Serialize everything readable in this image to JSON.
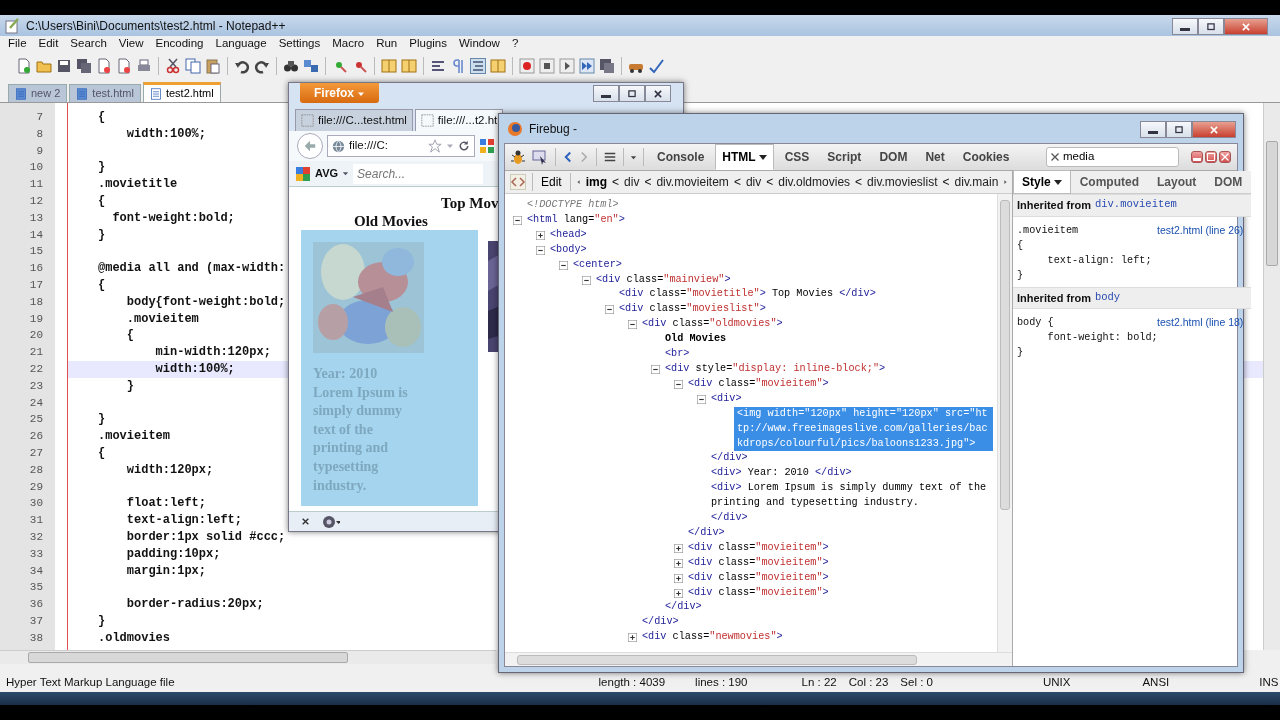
{
  "notepad": {
    "title": "C:\\Users\\Bini\\Documents\\test2.html - Notepad++",
    "menu": [
      "File",
      "Edit",
      "Search",
      "View",
      "Encoding",
      "Language",
      "Settings",
      "Macro",
      "Run",
      "Plugins",
      "Window",
      "?"
    ],
    "tabs": [
      {
        "label": "new 2",
        "selected": false
      },
      {
        "label": "test.html",
        "selected": false
      },
      {
        "label": "test2.html",
        "selected": true
      }
    ],
    "lines": [
      {
        "number": "7",
        "text": "{",
        "current": false
      },
      {
        "number": "8",
        "text": "    width:100%;",
        "current": false
      },
      {
        "number": "9",
        "current": false
      },
      {
        "number": "10",
        "text": "}",
        "current": false
      },
      {
        "number": "11",
        "text": ".movietitle",
        "current": false
      },
      {
        "number": "12",
        "text": "{",
        "current": false
      },
      {
        "number": "13",
        "text": "  font-weight:bold;",
        "current": false
      },
      {
        "number": "14",
        "text": "}",
        "current": false
      },
      {
        "number": "15",
        "current": false
      },
      {
        "number": "16",
        "text": "@media all and (max-width:",
        "current": false
      },
      {
        "number": "17",
        "text": "{",
        "current": false
      },
      {
        "number": "18",
        "text": "    body{font-weight:bold;",
        "current": false
      },
      {
        "number": "19",
        "text": "    .movieitem",
        "current": false
      },
      {
        "number": "20",
        "text": "    {",
        "current": false
      },
      {
        "number": "21",
        "text": "        min-width:120px;",
        "current": false
      },
      {
        "number": "22",
        "text": "        width:100%;",
        "current": true
      },
      {
        "number": "23",
        "text": "    }",
        "current": false
      },
      {
        "number": "24",
        "current": false
      },
      {
        "number": "25",
        "text": "}",
        "current": false
      },
      {
        "number": "26",
        "text": ".movieitem",
        "current": false
      },
      {
        "number": "27",
        "text": "{",
        "current": false
      },
      {
        "number": "28",
        "text": "    width:120px;",
        "current": false
      },
      {
        "number": "29",
        "current": false
      },
      {
        "number": "30",
        "text": "    float:left;",
        "current": false
      },
      {
        "number": "31",
        "text": "    text-align:left;",
        "current": false
      },
      {
        "number": "32",
        "text": "    border:1px solid #ccc;",
        "current": false
      },
      {
        "number": "33",
        "text": "    padding:10px;",
        "current": false
      },
      {
        "number": "34",
        "text": "    margin:1px;",
        "current": false
      },
      {
        "number": "35",
        "current": false
      },
      {
        "number": "36",
        "text": "    border-radius:20px;",
        "current": false
      },
      {
        "number": "37",
        "text": "}",
        "current": false
      },
      {
        "number": "38",
        "text": ".oldmovies",
        "current": false
      }
    ],
    "status_bar": {
      "file_type": "Hyper Text Markup Language file",
      "length": "length : 4039",
      "lines": "lines : 190",
      "line": "Ln : 22",
      "column": "Col : 23",
      "selection": "Sel : 0",
      "eol": "UNIX",
      "encoding": "ANSI",
      "mode": "INS"
    }
  },
  "firefox": {
    "menu_button": "Firefox",
    "tabs": [
      {
        "label": "file:///C...test.html",
        "selected": false
      },
      {
        "label": "file:///...t2.ht",
        "selected": true
      }
    ],
    "address": "file:///C:",
    "toolbar_brand": "AVG",
    "search": {
      "placeholder": "Search..."
    },
    "page": {
      "title": "Top Mov",
      "section": "Old Movies",
      "movie": {
        "year": "Year: 2010",
        "description": "Lorem Ipsum is simply dummy text of the printing and typesetting industry."
      }
    }
  },
  "firebug": {
    "title": "Firebug -",
    "panels": [
      {
        "label": "Console",
        "selected": false
      },
      {
        "label": "HTML",
        "selected": true,
        "menu": true
      },
      {
        "label": "CSS",
        "selected": false
      },
      {
        "label": "Script",
        "selected": false
      },
      {
        "label": "DOM",
        "selected": false
      },
      {
        "label": "Net",
        "selected": false
      },
      {
        "label": "Cookies",
        "selected": false
      }
    ],
    "search": {
      "value": "media"
    },
    "edit_button": "Edit",
    "breadcrumb": [
      {
        "label": "img",
        "selected": true,
        "separator": "<"
      },
      {
        "label": "div",
        "selected": false,
        "separator": "<"
      },
      {
        "label": "div.movieitem",
        "selected": false,
        "separator": "<"
      },
      {
        "label": "div",
        "selected": false,
        "separator": "<"
      },
      {
        "label": "div.oldmovies",
        "selected": false,
        "separator": "<"
      },
      {
        "label": "div.movieslist",
        "selected": false,
        "separator": "<"
      },
      {
        "label": "div.main",
        "selected": false
      }
    ],
    "side_tabs": [
      {
        "label": "Style",
        "selected": true,
        "menu": true
      },
      {
        "label": "Computed",
        "selected": false
      },
      {
        "label": "Layout",
        "selected": false
      },
      {
        "label": "DOM",
        "selected": false
      }
    ],
    "tree": [
      {
        "kind": "doctype",
        "text": "<!DOCTYPE html>",
        "selected": false
      },
      {
        "kind": "element",
        "text": "<html lang=\"en\">",
        "expanded": true,
        "selected": false,
        "children": [
          {
            "kind": "element",
            "text": "<head>",
            "expanded": false,
            "selected": false
          },
          {
            "kind": "element",
            "text": "<body>",
            "expanded": true,
            "selected": false,
            "children": [
              {
                "kind": "element",
                "text": "<center>",
                "expanded": true,
                "selected": false,
                "children": [
                  {
                    "kind": "element",
                    "text": "<div class=\"mainview\">",
                    "expanded": true,
                    "selected": false,
                    "children": [
                      {
                        "kind": "element",
                        "text": "<div class=\"movietitle\"> Top Movies </div>",
                        "selected": false
                      },
                      {
                        "kind": "element",
                        "text": "<div class=\"movieslist\">",
                        "expanded": true,
                        "selected": false,
                        "children": [
                          {
                            "kind": "element",
                            "text": "<div class=\"oldmovies\">",
                            "expanded": true,
                            "selected": false,
                            "close": "</div>",
                            "children": [
                              {
                                "kind": "text",
                                "text": "Old Movies",
                                "selected": false
                              },
                              {
                                "kind": "element",
                                "text": "<br>",
                                "selected": false
                              },
                              {
                                "kind": "element",
                                "text": "<div style=\"display: inline-block;\">",
                                "expanded": true,
                                "selected": false,
                                "close": "</div>",
                                "children": [
                                  {
                                    "kind": "element",
                                    "text": "<div class=\"movieitem\">",
                                    "expanded": true,
                                    "selected": false,
                                    "close": "</div>",
                                    "children": [
                                      {
                                        "kind": "element",
                                        "text": "<div>",
                                        "expanded": true,
                                        "selected": false,
                                        "close": "</div>",
                                        "children": [
                                          {
                                            "kind": "element",
                                            "text": "<img width=\"120px\" height=\"120px\" src=\"http://www.freeimageslive.com/galleries/backdrops/colourful/pics/baloons1233.jpg\">",
                                            "selected": true
                                          }
                                        ]
                                      },
                                      {
                                        "kind": "element",
                                        "text": "<div> Year: 2010 </div>",
                                        "selected": false
                                      },
                                      {
                                        "kind": "element",
                                        "text": "<div> Lorem Ipsum is simply dummy text of the printing and typesetting industry.",
                                        "close": "</div>",
                                        "selected": false
                                      }
                                    ]
                                  },
                                  {
                                    "kind": "element",
                                    "text": "<div class=\"movieitem\">",
                                    "expanded": false,
                                    "selected": false
                                  },
                                  {
                                    "kind": "element",
                                    "text": "<div class=\"movieitem\">",
                                    "expanded": false,
                                    "selected": false
                                  },
                                  {
                                    "kind": "element",
                                    "text": "<div class=\"movieitem\">",
                                    "expanded": false,
                                    "selected": false
                                  },
                                  {
                                    "kind": "element",
                                    "text": "<div class=\"movieitem\">",
                                    "expanded": false,
                                    "selected": false
                                  }
                                ]
                              }
                            ]
                          },
                          {
                            "kind": "element",
                            "text": "<div class=\"newmovies\">",
                            "expanded": false,
                            "selected": false
                          }
                        ]
                      }
                    ]
                  }
                ]
              }
            ]
          }
        ]
      }
    ],
    "styles": [
      {
        "heading": "Inherited from",
        "source": "div.movieitem",
        "rules": [
          {
            "selector": ".movieitem",
            "link": "test2.html (line 26)",
            "lines": [
              "{",
              "text-align: left;",
              "}"
            ]
          }
        ]
      },
      {
        "heading": "Inherited from",
        "source": "body",
        "rules": [
          {
            "selector": "body {",
            "link": "test2.html (line 18)",
            "lines": [
              "font-weight: bold;",
              "}"
            ]
          }
        ]
      }
    ]
  }
}
